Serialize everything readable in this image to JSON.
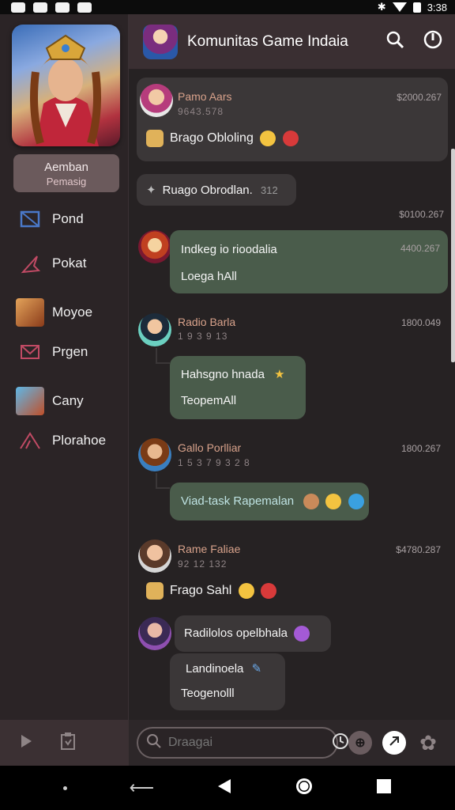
{
  "status_bar": {
    "time": "3:38"
  },
  "sidebar": {
    "profile": {
      "line1": "Aemban",
      "line2": "Pemasig"
    },
    "items": [
      {
        "label": "Pond",
        "icon": "mail-icon"
      },
      {
        "label": "Pokat",
        "icon": "arrow-icon"
      },
      {
        "label": "Moyoe",
        "icon": "game-thumb-icon"
      },
      {
        "label": "Prgen",
        "icon": "envelope-icon"
      },
      {
        "label": "Cany",
        "icon": "game-thumb-icon"
      },
      {
        "label": "Plorahoe",
        "icon": "tent-icon"
      }
    ]
  },
  "header": {
    "title": "Komunitas Game Indaia"
  },
  "messages": {
    "m1": {
      "name": "Pamo Aars",
      "sub": "9643.578",
      "time": "$2000.267",
      "text": "Brago Obloling"
    },
    "m2": {
      "text": "Ruago Obrodlan.",
      "extra": "312",
      "time": "$0100.267"
    },
    "m3": {
      "text": "Indkeg io rioodalia",
      "reply": "Loega hAll",
      "time": "4400.267"
    },
    "m4": {
      "name": "Radio Barla",
      "sub": "1 9 3 9 13",
      "time": "1800.049"
    },
    "m5": {
      "text": "Hahsgno hnada",
      "reply": "TeopemAll"
    },
    "m6": {
      "name": "Gallo Porlliar",
      "sub": "1 5 3 7 9 3 2 8",
      "time": "1800.267",
      "text": "Viad-task Rapemalan"
    },
    "m7": {
      "name": "Rame Faliae",
      "sub": "92 12 132",
      "time": "$4780.287",
      "text": "Frago Sahl"
    },
    "m8": {
      "text": "Radilolos opelbhala",
      "reply1": "Landinoela",
      "reply2": "Teogenolll"
    }
  },
  "composer": {
    "placeholder": "Draagai"
  }
}
